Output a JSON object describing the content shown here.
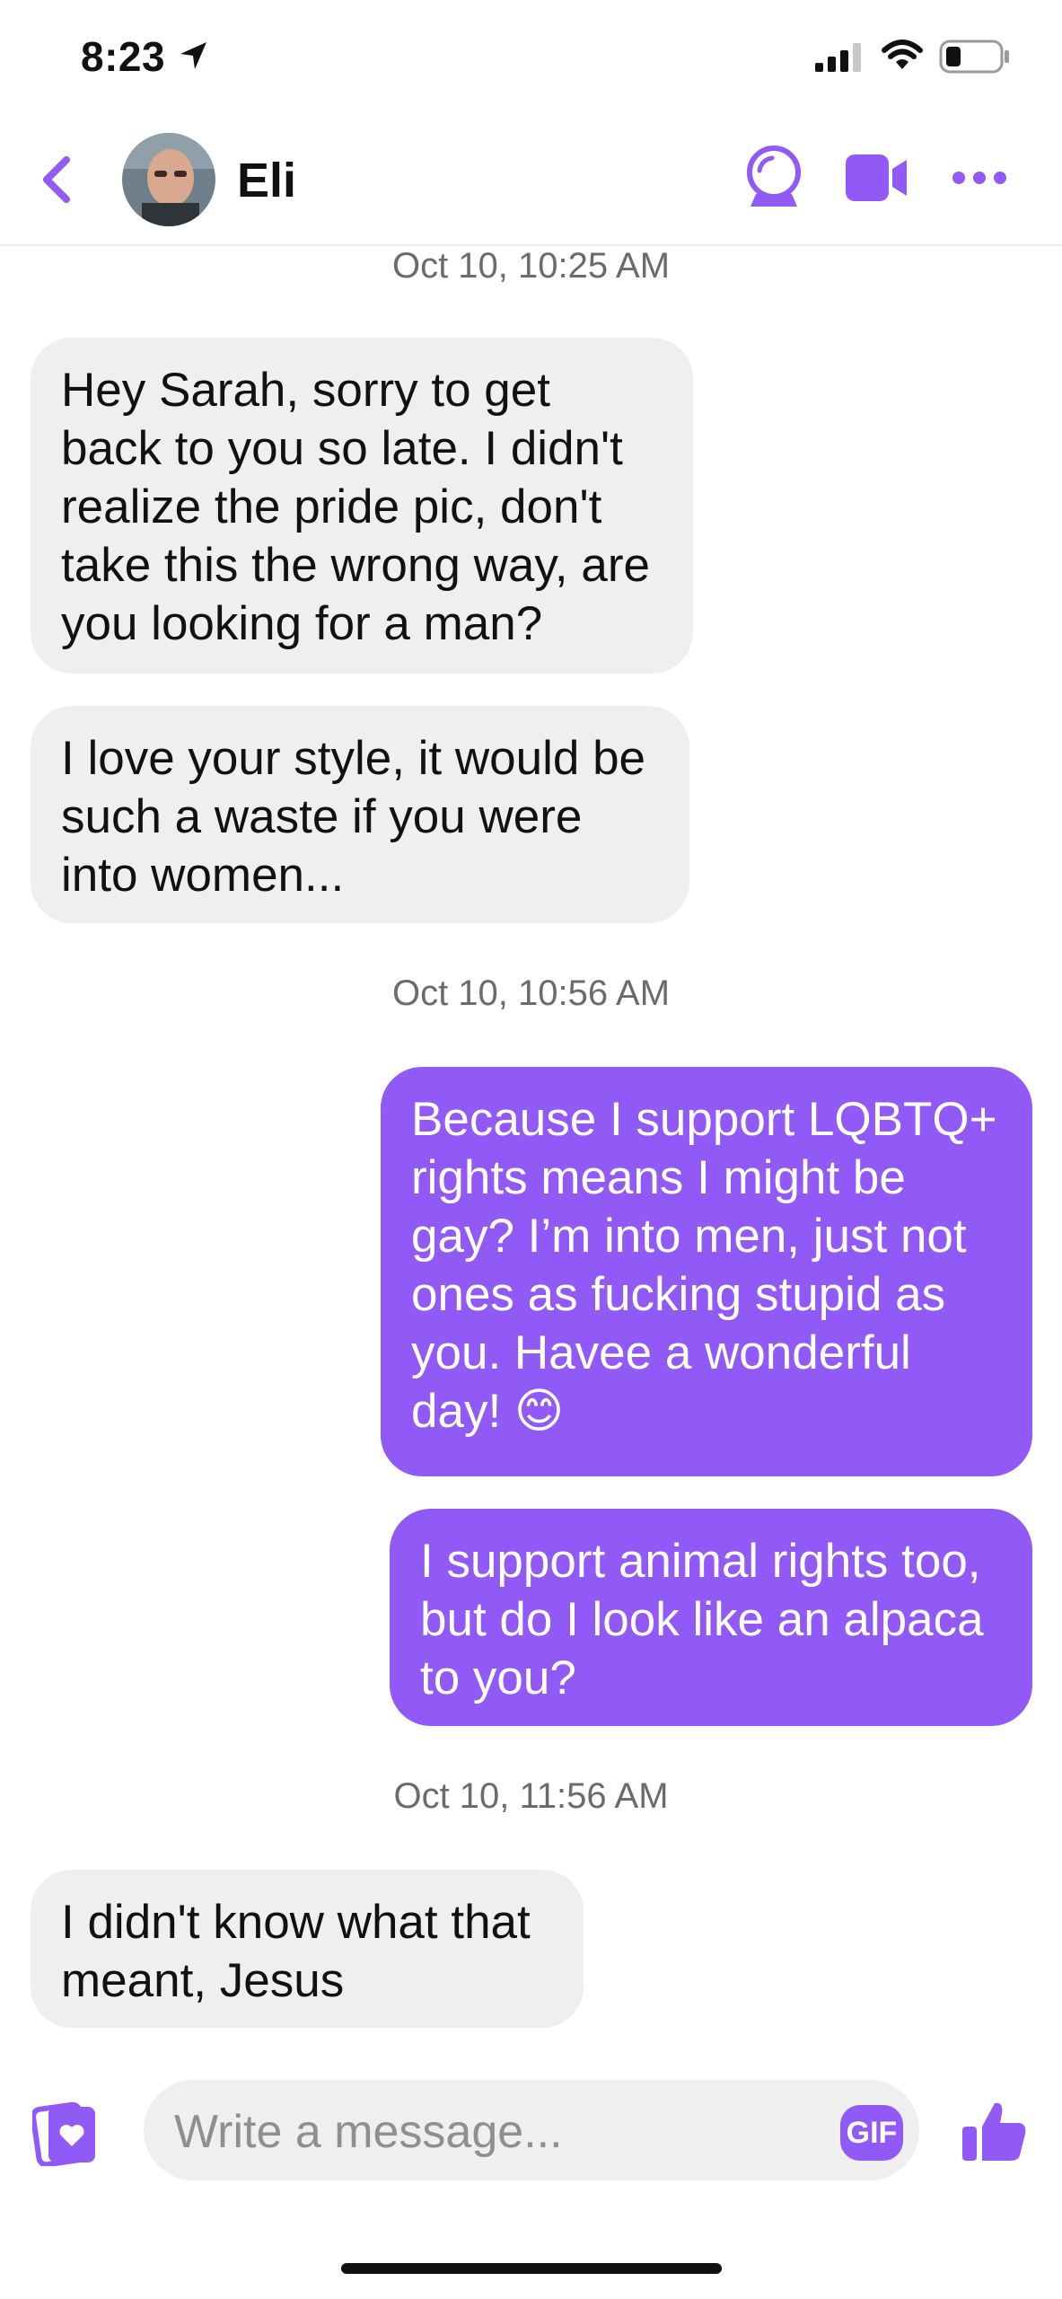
{
  "status_bar": {
    "time": "8:23",
    "icons": [
      "location-arrow-icon",
      "signal-icon",
      "wifi-icon",
      "battery-icon"
    ]
  },
  "header": {
    "contact_name": "Eli",
    "icons": [
      "back-icon",
      "avatar",
      "ai-assistant-icon",
      "video-call-icon",
      "more-icon"
    ]
  },
  "messages": [
    {
      "timestamp": "Oct 10, 10:25 AM"
    },
    {
      "direction": "incoming",
      "lines": [
        "Hey Sarah, sorry to get",
        "back to you so late.  I didn't",
        "realize the pride pic, don't",
        "take this the wrong way, are",
        "you looking for a man?"
      ]
    },
    {
      "direction": "incoming",
      "lines": [
        "I love your style, it would be",
        "such a waste if you were",
        "into women..."
      ]
    },
    {
      "timestamp": "Oct 10, 10:56 AM"
    },
    {
      "direction": "outgoing",
      "lines": [
        "Because I support LQBTQ+",
        "rights means I might be",
        "gay? I’m into men, just not",
        "ones as fucking stupid as",
        "you. Havee a wonderful",
        "day! 😊"
      ]
    },
    {
      "direction": "outgoing",
      "lines": [
        "I support animal rights too,",
        "but do I look like an alpaca",
        "to you?"
      ]
    },
    {
      "timestamp": "Oct 10, 11:56 AM"
    },
    {
      "direction": "incoming",
      "lines": [
        "I didn't know what that",
        "meant, Jesus"
      ]
    }
  ],
  "composer": {
    "placeholder": "Write a message...",
    "gif_label": "GIF",
    "icons": [
      "sticker-card-icon",
      "gif-icon",
      "thumbs-up-icon"
    ]
  },
  "colors": {
    "accent": "#9159f6",
    "incoming_bubble": "#efeff0",
    "timestamp_text": "#6b6b6b"
  }
}
